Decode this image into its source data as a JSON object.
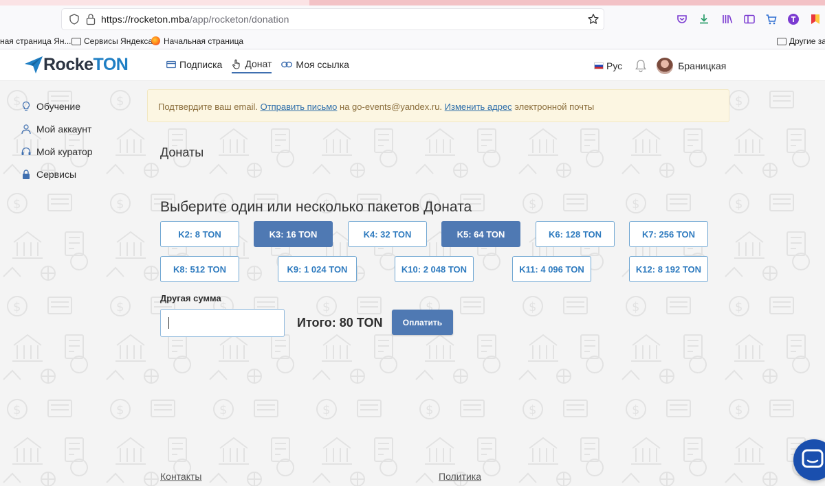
{
  "browser": {
    "url_host": "https://rocketon.mba",
    "url_path": "/app/rocketon/donation",
    "bookmarks": [
      "ная страница Ян...",
      "Сервисы Яндекса",
      "Начальная страница",
      "Другие зак"
    ]
  },
  "header": {
    "logo_part1": "Rocke",
    "logo_part2": "TON",
    "nav": [
      {
        "label": "Подписка",
        "icon": "card-icon"
      },
      {
        "label": "Донат",
        "icon": "hand-pointer-icon",
        "active": true
      },
      {
        "label": "Моя ссылка",
        "icon": "link-icon"
      }
    ],
    "language": "Рус",
    "username": "Браницкая"
  },
  "sidebar": {
    "items": [
      {
        "label": "Обучение",
        "icon": "lightbulb-icon"
      },
      {
        "label": "Мой аккаунт",
        "icon": "user-icon"
      },
      {
        "label": "Мой куратор",
        "icon": "headset-icon"
      },
      {
        "label": "Сервисы",
        "icon": "lock-icon"
      }
    ]
  },
  "alert": {
    "text1": "Подтвердите ваш email. ",
    "link1": "Отправить письмо",
    "text2": " на go-events@yandex.ru. ",
    "link2": "Изменить адрес",
    "text3": " электронной почты"
  },
  "main": {
    "page_title": "Донаты",
    "section_title": "Выберите один или несколько пакетов Доната",
    "packages": [
      {
        "label": "K2: 8 TON",
        "selected": false
      },
      {
        "label": "K3: 16 TON",
        "selected": true
      },
      {
        "label": "K4: 32 TON",
        "selected": false
      },
      {
        "label": "K5: 64 TON",
        "selected": true
      },
      {
        "label": "K6: 128 TON",
        "selected": false
      },
      {
        "label": "K7: 256 TON",
        "selected": false
      },
      {
        "label": "K8: 512 TON",
        "selected": false
      },
      {
        "label": "K9: 1 024 TON",
        "selected": false
      },
      {
        "label": "K10: 2 048 TON",
        "selected": false
      },
      {
        "label": "K11: 4 096 TON",
        "selected": false
      },
      {
        "label": "K12: 8 192 TON",
        "selected": false
      }
    ],
    "other_amount_label": "Другая сумма",
    "other_amount_value": "",
    "total": "Итого: 80 TON",
    "pay_button": "Оплатить"
  },
  "footer": {
    "contacts": "Контакты",
    "policy": "Политика"
  },
  "colors": {
    "accent": "#4f79b3",
    "package_border": "#6fa6d2",
    "package_text": "#2f7bbf",
    "alert_bg": "#fcf6e2",
    "alert_text": "#8a6d3b",
    "chat_bubble": "#1a4fae"
  }
}
